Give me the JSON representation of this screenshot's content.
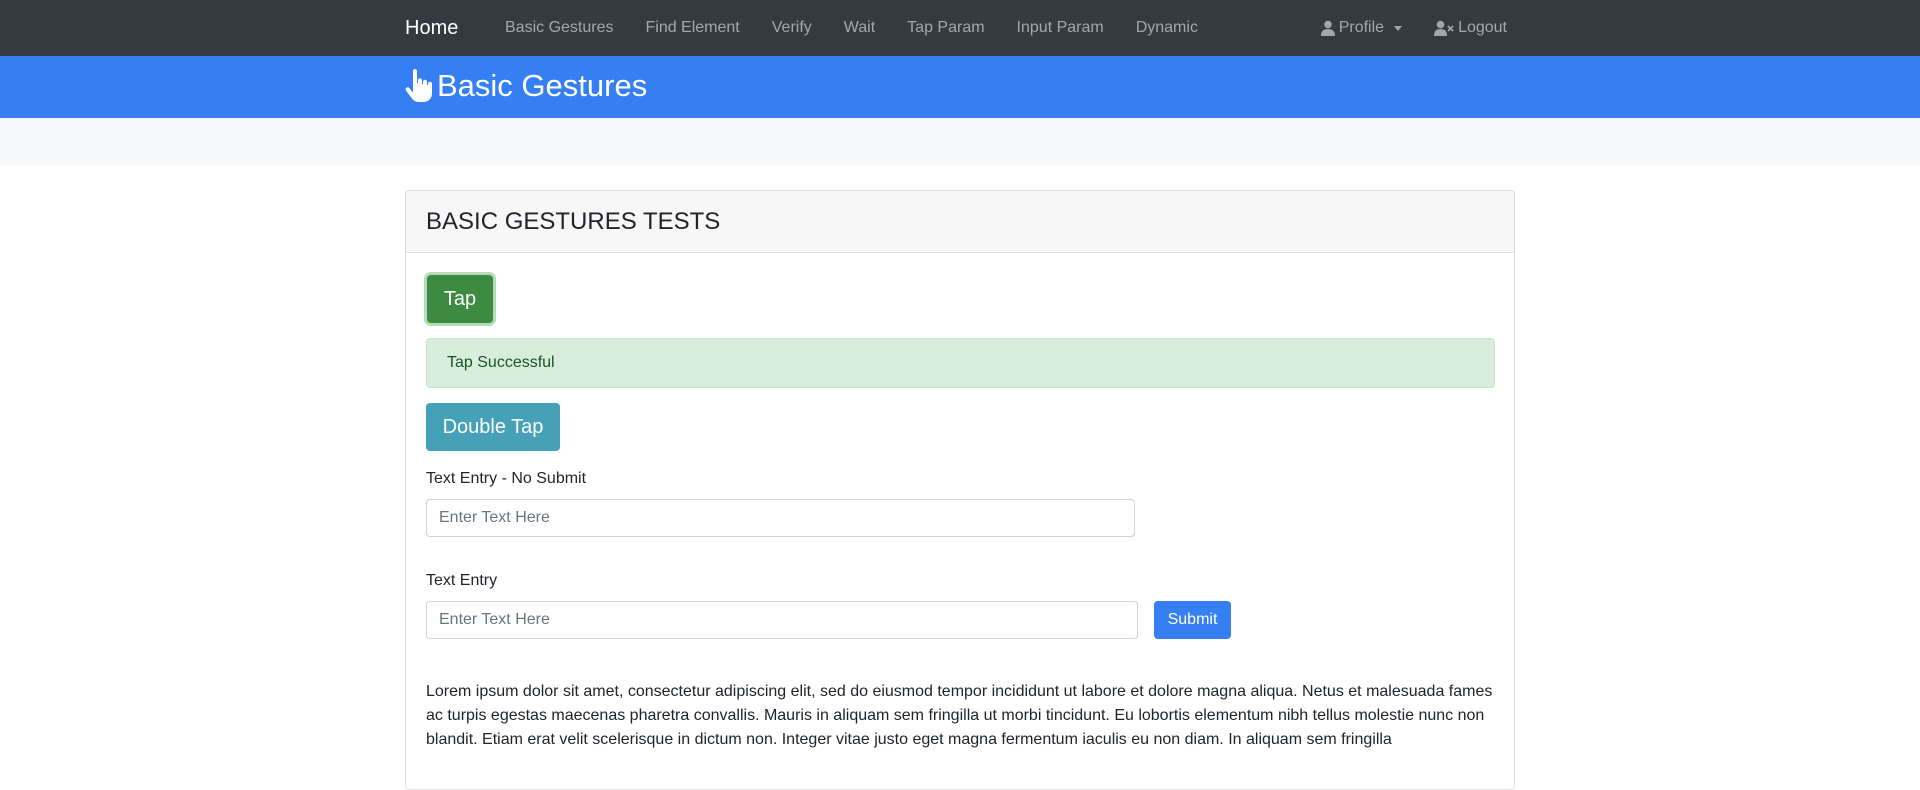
{
  "navbar": {
    "brand": "Home",
    "links": [
      "Basic Gestures",
      "Find Element",
      "Verify",
      "Wait",
      "Tap Param",
      "Input Param",
      "Dynamic"
    ],
    "profile_label": "Profile",
    "logout_label": "Logout",
    "profile_icon": "user-icon",
    "logout_icon": "user-times-icon"
  },
  "header": {
    "title": "Basic Gestures",
    "icon": "hand-pointer-icon"
  },
  "card": {
    "title": "BASIC GESTURES TESTS",
    "tap_label": "Tap",
    "tap_message": "Tap Successful",
    "double_tap_label": "Double Tap",
    "text_entry_no_submit_label": "Text Entry - No Submit",
    "text_entry_no_submit_placeholder": "Enter Text Here",
    "text_entry_label": "Text Entry",
    "text_entry_placeholder": "Enter Text Here",
    "submit_label": "Submit",
    "lorem": "Lorem ipsum dolor sit amet, consectetur adipiscing elit, sed do eiusmod tempor incididunt ut labore et dolore magna aliqua. Netus et malesuada fames ac turpis egestas maecenas pharetra convallis. Mauris in aliquam sem fringilla ut morbi tincidunt. Eu lobortis elementum nibh tellus molestie nunc non blandit. Etiam erat velit scelerisque in dictum non. Integer vitae justo eget magna fermentum iaculis eu non diam. In aliquam sem fringilla"
  },
  "colors": {
    "navbar_bg": "#343a40",
    "header_bg": "#357ff2",
    "tap_button": "#3d8b40",
    "double_tap_button": "#44a1b7",
    "alert_bg": "#d9eddd",
    "submit_button": "#357ff2"
  }
}
